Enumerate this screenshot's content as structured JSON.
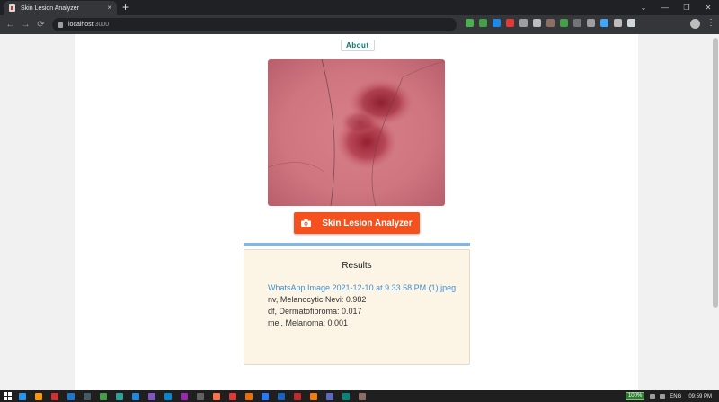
{
  "browser": {
    "tab_title": "Skin Lesion Analyzer",
    "tab_close": "×",
    "new_tab": "+",
    "url_host": "localhost",
    "url_port": ":3000",
    "back": "←",
    "forward": "→",
    "reload": "⟳",
    "menu": "⋮",
    "window_controls": [
      "⌄",
      "—",
      "❐",
      "✕"
    ],
    "extension_colors": [
      "#4caf50",
      "#43a047",
      "#1e88e5",
      "#e53935",
      "#9e9e9e",
      "#bdbdbd",
      "#8d6e63",
      "#43a047",
      "#757575",
      "#9e9e9e",
      "#42a5f5",
      "#bdbdbd",
      "#cfd8dc"
    ]
  },
  "page": {
    "about_label": "About",
    "analyze_button_label": "Skin Lesion Analyzer",
    "results": {
      "title": "Results",
      "file_name": "WhatsApp Image 2021-12-10 at 9.33.58 PM (1).jpeg",
      "predictions": [
        "nv, Melanocytic Nevi: 0.982",
        "df, Dermatofibroma: 0.017",
        "mel, Melanoma: 0.001"
      ]
    },
    "colors": {
      "accent_button": "#f4511e",
      "about_text": "#00796b",
      "link": "#3f8fd2",
      "results_bg": "#fcf4e5",
      "progress": "#7cb9e8"
    }
  },
  "taskbar": {
    "battery": "100%",
    "language": "ENG",
    "time": "09:59 PM",
    "app_colors": [
      "#2196f3",
      "#ff9800",
      "#d32f2f",
      "#1976d2",
      "#455a64",
      "#43a047",
      "#26a69a",
      "#1e88e5",
      "#7e57c2",
      "#0288d1",
      "#9c27b0",
      "#616161",
      "#ff7043",
      "#e53935",
      "#ef6c00",
      "#2979ff",
      "#1565c0",
      "#c62828",
      "#f57c00",
      "#5c6bc0",
      "#00897b",
      "#8d6e63"
    ]
  }
}
